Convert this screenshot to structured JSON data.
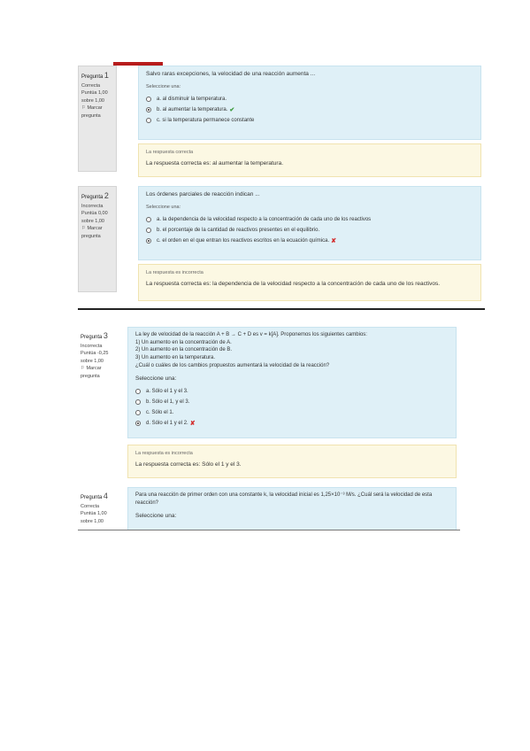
{
  "page1": {
    "q1": {
      "label": "Pregunta",
      "num": "1",
      "status": "Correcta",
      "score_line1": "Puntúa 1,00",
      "score_line2": "sobre 1,00",
      "flag": "Marcar pregunta",
      "text": "Salvo raras excepciones, la velocidad de una reacción aumenta ...",
      "prompt": "Seleccione una:",
      "options": [
        {
          "text": "a. al disminuir la temperatura.",
          "checked": false,
          "mark": ""
        },
        {
          "text": "b. al aumentar la temperatura.",
          "checked": true,
          "mark": "✔"
        },
        {
          "text": "c. si la temperatura permanece constante",
          "checked": false,
          "mark": ""
        }
      ],
      "feedback_title": "La respuesta correcta",
      "feedback_text": "La respuesta correcta es: al aumentar la temperatura."
    },
    "q2": {
      "label": "Pregunta",
      "num": "2",
      "status": "Incorrecta",
      "score_line1": "Puntúa 0,00",
      "score_line2": "sobre 1,00",
      "flag": "Marcar pregunta",
      "text": "Los órdenes parciales de reacción indican ...",
      "prompt": "Seleccione una:",
      "options": [
        {
          "text": "a. la dependencia de la velocidad respecto a la concentración de cada uno de los reactivos",
          "checked": false,
          "mark": ""
        },
        {
          "text": "b. el porcentaje de la cantidad de reactivos presentes en el equilibrio.",
          "checked": false,
          "mark": ""
        },
        {
          "text": "c. el orden en el que entran los reactivos escritos en la ecuación química.",
          "checked": true,
          "mark": "✘"
        }
      ],
      "feedback_title": "La respuesta es incorrecta",
      "feedback_text": "La respuesta correcta es: la dependencia de la velocidad respecto a la concentración de cada uno de los reactivos."
    }
  },
  "page2": {
    "q3": {
      "label": "Pregunta",
      "num": "3",
      "status": "Incorrecta",
      "score_line1": "Puntúa -0,25",
      "score_line2": "sobre 1,00",
      "flag": "Marcar pregunta",
      "text_lines": [
        "La ley de velocidad de la reacción A + B → C + D es v = k[A]. Proponemos los siguientes cambios:",
        "1) Un aumento en la concentración de A.",
        "2) Un aumento en la concentración de B.",
        "3) Un aumento en la temperatura.",
        "¿Cuál o cuáles de los cambios propuestos aumentará la velocidad de la reacción?"
      ],
      "prompt": "Seleccione una:",
      "options": [
        {
          "text": "a. Sólo el 1 y el 3.",
          "checked": false,
          "mark": ""
        },
        {
          "text": "b. Sólo el 1, y el 3.",
          "checked": false,
          "mark": ""
        },
        {
          "text": "c. Sólo el 1.",
          "checked": false,
          "mark": ""
        },
        {
          "text": "d. Sólo el 1 y el 2.",
          "checked": true,
          "mark": "✘"
        }
      ],
      "feedback_title": "La respuesta es incorrecta",
      "feedback_text": "La respuesta correcta es: Sólo el 1 y el 3."
    },
    "q4": {
      "label": "Pregunta",
      "num": "4",
      "status": "Correcta",
      "score_line1": "Puntúa 1,00",
      "score_line2": "sobre 1,00",
      "text": "Para una reacción de primer orden con una constante k, la velocidad inicial es 1,25×10⁻³ M/s. ¿Cuál será la velocidad de esta reacción?",
      "prompt": "Seleccione una:"
    }
  }
}
